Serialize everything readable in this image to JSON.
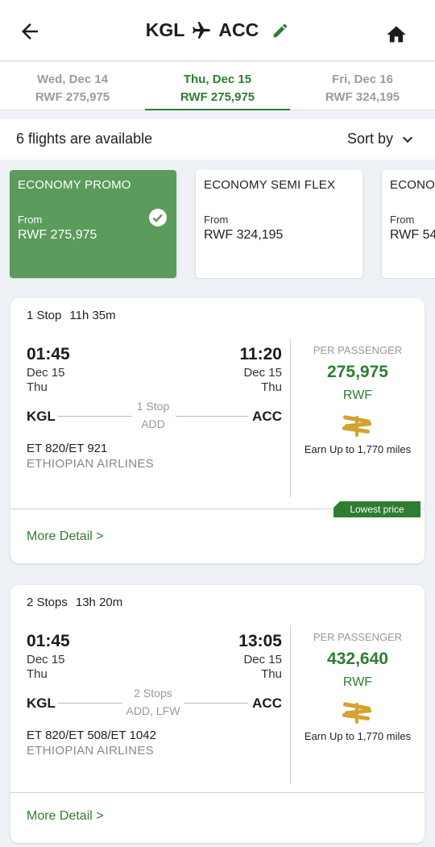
{
  "header": {
    "origin": "KGL",
    "destination": "ACC"
  },
  "dates": [
    {
      "day": "Wed, Dec 14",
      "price": "RWF 275,975",
      "active": false
    },
    {
      "day": "Thu, Dec 15",
      "price": "RWF 275,975",
      "active": true
    },
    {
      "day": "Fri, Dec 16",
      "price": "RWF 324,195",
      "active": false
    }
  ],
  "results": {
    "count_text": "6 flights are available",
    "sort_label": "Sort by"
  },
  "fares": [
    {
      "name": "ECONOMY PROMO",
      "from": "From",
      "price": "RWF 275,975",
      "selected": true
    },
    {
      "name": "ECONOMY SEMI FLEX",
      "from": "From",
      "price": "RWF 324,195",
      "selected": false
    },
    {
      "name": "ECONOMY FLEX",
      "from": "From",
      "price": "RWF 54",
      "selected": false
    }
  ],
  "flights": [
    {
      "stops_summary": "1 Stop",
      "duration": "11h 35m",
      "dep_time": "01:45",
      "dep_date": "Dec 15",
      "dep_day": "Thu",
      "arr_time": "11:20",
      "arr_date": "Dec 15",
      "arr_day": "Thu",
      "origin": "KGL",
      "destination": "ACC",
      "stops_label": "1 Stop",
      "stops_via": "ADD",
      "flight_numbers": "ET 820/ET 921",
      "airline": "ETHIOPIAN AIRLINES",
      "per_passenger": "PER PASSENGER",
      "price": "275,975",
      "currency": "RWF",
      "miles": "Earn Up to 1,770 miles",
      "badge": "Lowest price",
      "more": "More Detail >"
    },
    {
      "stops_summary": "2 Stops",
      "duration": "13h 20m",
      "dep_time": "01:45",
      "dep_date": "Dec 15",
      "dep_day": "Thu",
      "arr_time": "13:05",
      "arr_date": "Dec 15",
      "arr_day": "Thu",
      "origin": "KGL",
      "destination": "ACC",
      "stops_label": "2 Stops",
      "stops_via": "ADD, LFW",
      "flight_numbers": "ET 820/ET 508/ET 1042",
      "airline": "ETHIOPIAN AIRLINES",
      "per_passenger": "PER PASSENGER",
      "price": "432,640",
      "currency": "RWF",
      "miles": "Earn Up to 1,770 miles",
      "more": "More Detail >"
    }
  ],
  "colors": {
    "accent": "#2f7d32",
    "selected_fare": "#5b9b5b",
    "miles_icon": "#d4a22e"
  },
  "icons": {
    "back": "arrow-left-icon",
    "plane": "airplane-icon",
    "edit": "pencil-icon",
    "home": "home-icon",
    "sort": "chevron-down-icon",
    "check": "check-circle-icon",
    "miles": "miles-reward-icon"
  }
}
